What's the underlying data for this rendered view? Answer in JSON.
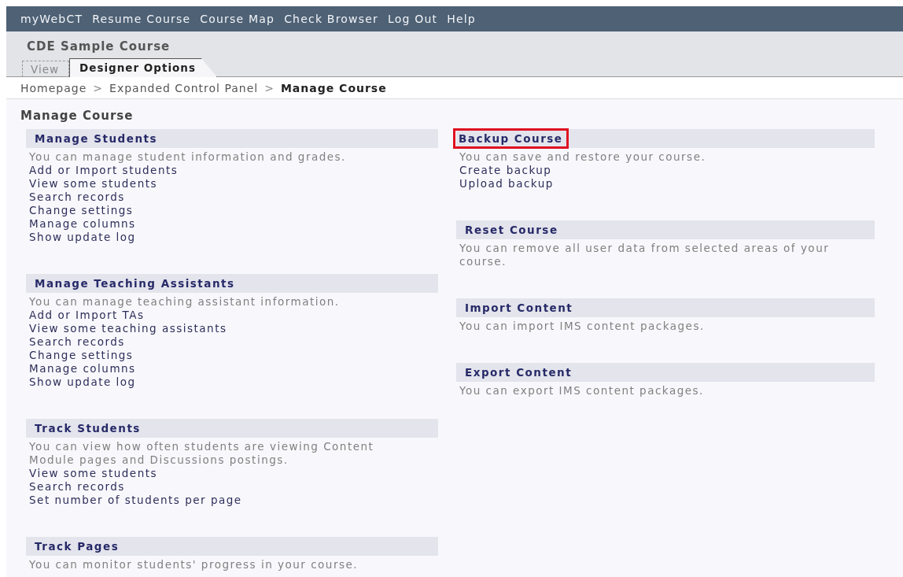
{
  "top_nav": [
    "myWebCT",
    "Resume Course",
    "Course Map",
    "Check Browser",
    "Log Out",
    "Help"
  ],
  "course_title": "CDE Sample Course",
  "tabs": [
    {
      "label": "View",
      "selected": false
    },
    {
      "label": "Designer Options",
      "selected": true
    }
  ],
  "breadcrumb": [
    {
      "label": "Homepage",
      "current": false
    },
    {
      "label": "Expanded Control Panel",
      "current": false
    },
    {
      "label": "Manage Course",
      "current": true
    }
  ],
  "breadcrumb_separator": ">",
  "page_title": "Manage Course",
  "columns": [
    {
      "sections": [
        {
          "title": "Manage Students",
          "highlighted": false,
          "description": "You can manage student information and grades.",
          "links": [
            "Add or Import students",
            "View some students",
            "Search records",
            "Change settings",
            "Manage columns",
            "Show update log"
          ]
        },
        {
          "title": "Manage Teaching Assistants",
          "highlighted": false,
          "description": "You can manage teaching assistant information.",
          "links": [
            "Add or Import TAs",
            "View some teaching assistants",
            "Search records",
            "Change settings",
            "Manage columns",
            "Show update log"
          ]
        },
        {
          "title": "Track Students",
          "highlighted": false,
          "description": "You can view how often students are viewing Content Module pages and Discussions postings.",
          "links": [
            "View some students",
            "Search records",
            "Set number of students per page"
          ]
        },
        {
          "title": "Track Pages",
          "highlighted": false,
          "description": "You can monitor students' progress in your course."
        }
      ]
    },
    {
      "sections": [
        {
          "title": "Backup Course",
          "highlighted": true,
          "description": "You can save and restore your course.",
          "links": [
            "Create backup",
            "Upload backup"
          ]
        },
        {
          "title": "Reset Course",
          "highlighted": false,
          "description": "You can remove all user data from selected areas of your course."
        },
        {
          "title": "Import Content",
          "highlighted": false,
          "description": "You can import IMS content packages."
        },
        {
          "title": "Export Content",
          "highlighted": false,
          "description": "You can export IMS content packages."
        }
      ]
    }
  ]
}
